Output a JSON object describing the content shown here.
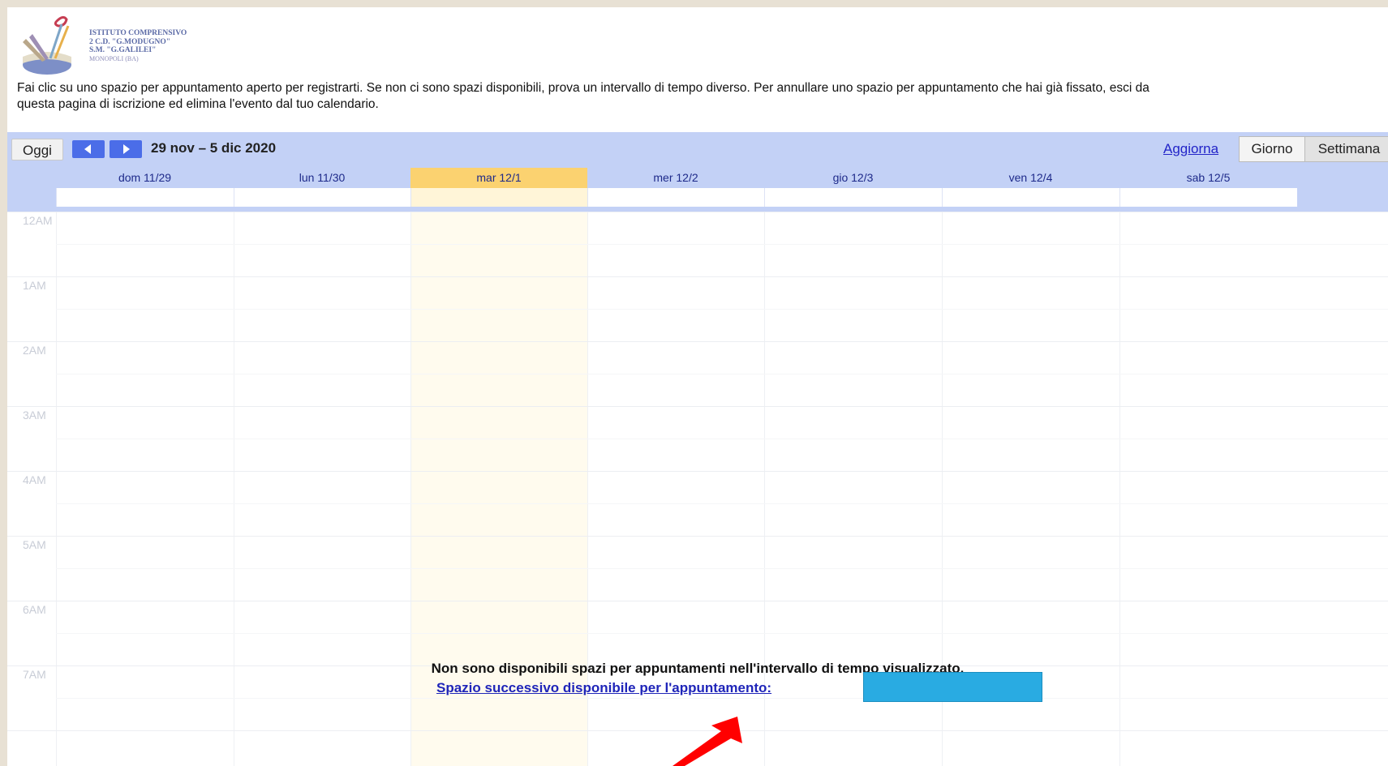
{
  "logo": {
    "line1": "ISTITUTO COMPRENSIVO",
    "line2": "2 C.D. \"G.MODUGNO\"",
    "line3": "S.M. \"G.GALILEI\"",
    "line4": "MONOPOLI (BA)"
  },
  "intro": {
    "line1": "Fai clic su uno spazio per appuntamento aperto per registrarti. Se non ci sono spazi disponibili, prova un intervallo di tempo diverso. Per annullare uno spazio per appuntamento che hai già fissato, esci da",
    "line2": "questa pagina di iscrizione ed elimina l'evento dal tuo calendario."
  },
  "toolbar": {
    "today_label": "Oggi",
    "range_label": "29 nov – 5 dic 2020",
    "refresh_label": "Aggiorna",
    "view_day": "Giorno",
    "view_week": "Settimana"
  },
  "days": [
    {
      "label": "dom 11/29",
      "today": false
    },
    {
      "label": "lun 11/30",
      "today": false
    },
    {
      "label": "mar 12/1",
      "today": true
    },
    {
      "label": "mer 12/2",
      "today": false
    },
    {
      "label": "gio 12/3",
      "today": false
    },
    {
      "label": "ven 12/4",
      "today": false
    },
    {
      "label": "sab 12/5",
      "today": false
    }
  ],
  "hours": [
    "12AM",
    "1AM",
    "2AM",
    "3AM",
    "4AM",
    "5AM",
    "6AM",
    "7AM"
  ],
  "message": {
    "no_slots": "Non sono disponibili spazi per appuntamenti nell'intervallo di tempo visualizzato.",
    "next_slot": "Spazio successivo disponibile per l'appuntamento:"
  },
  "colors": {
    "toolbar_bg": "#c3d1f6",
    "today_header": "#fbd270",
    "nav_button": "#4b6de8",
    "link": "#1f25b9",
    "redacted_box": "#29abe2",
    "annotation_arrow": "#ff0000"
  }
}
